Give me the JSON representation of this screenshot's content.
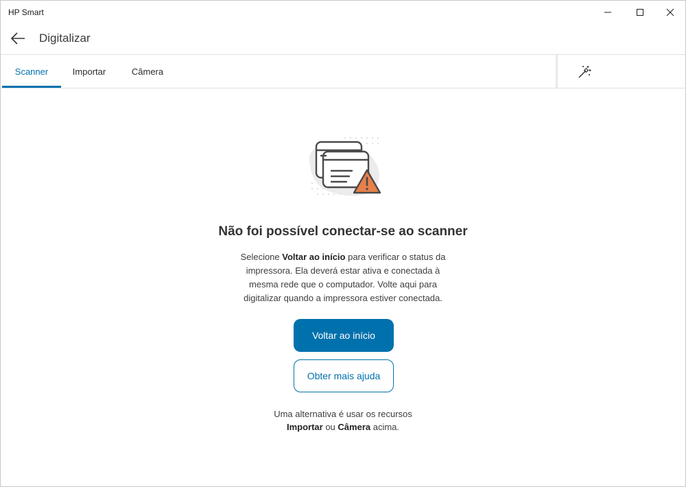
{
  "window": {
    "app_title": "HP Smart"
  },
  "header": {
    "title": "Digitalizar"
  },
  "tabs": [
    {
      "label": "Scanner",
      "active": true
    },
    {
      "label": "Importar",
      "active": false
    },
    {
      "label": "Câmera",
      "active": false
    }
  ],
  "icons": {
    "back": "arrow-left-icon",
    "magic": "magic-wand-icon",
    "illustration": "scanner-warning-icon",
    "minimize": "minimize-icon",
    "maximize": "maximize-icon",
    "close": "close-icon"
  },
  "colors": {
    "accent": "#0171ad",
    "warning": "#e8804a"
  },
  "error": {
    "title": "Não foi possível conectar-se ao scanner",
    "desc_pre": "Selecione ",
    "desc_bold": "Voltar ao início",
    "desc_post": " para verificar o status da impressora. Ela deverá estar ativa e conectada à mesma rede que o computador. Volte aqui para digitalizar quando a impressora estiver conectada."
  },
  "buttons": {
    "primary": "Voltar ao início",
    "secondary": "Obter mais ajuda"
  },
  "alternative": {
    "line1": "Uma alternativa é usar os recursos",
    "bold1": "Importar",
    "mid": " ou ",
    "bold2": "Câmera",
    "end": " acima."
  }
}
